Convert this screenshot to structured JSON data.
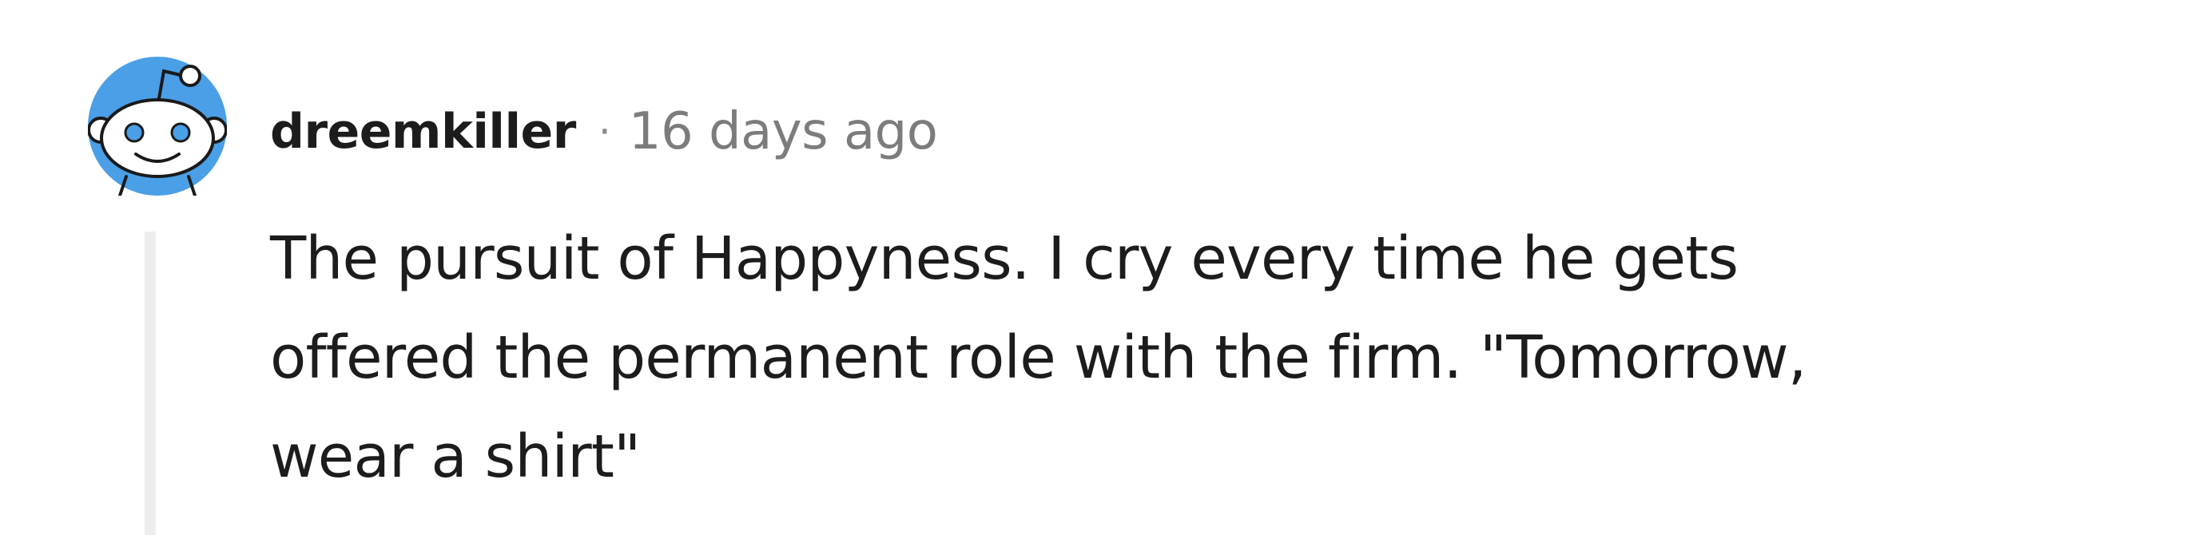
{
  "comment": {
    "author": "dreemkiller",
    "separator": "·",
    "timestamp": "16 days ago",
    "avatar_icon": "snoo-avatar-icon",
    "text_lines": [
      "The pursuit of Happyness. I cry every time he gets",
      "offered the permanent role with the firm. \"Tomorrow,",
      "wear a shirt\""
    ]
  },
  "colors": {
    "avatar_bg": "#4a9fe6",
    "thread_line": "#ededed",
    "text": "#1c1c1c",
    "meta": "#7c7c7c"
  }
}
